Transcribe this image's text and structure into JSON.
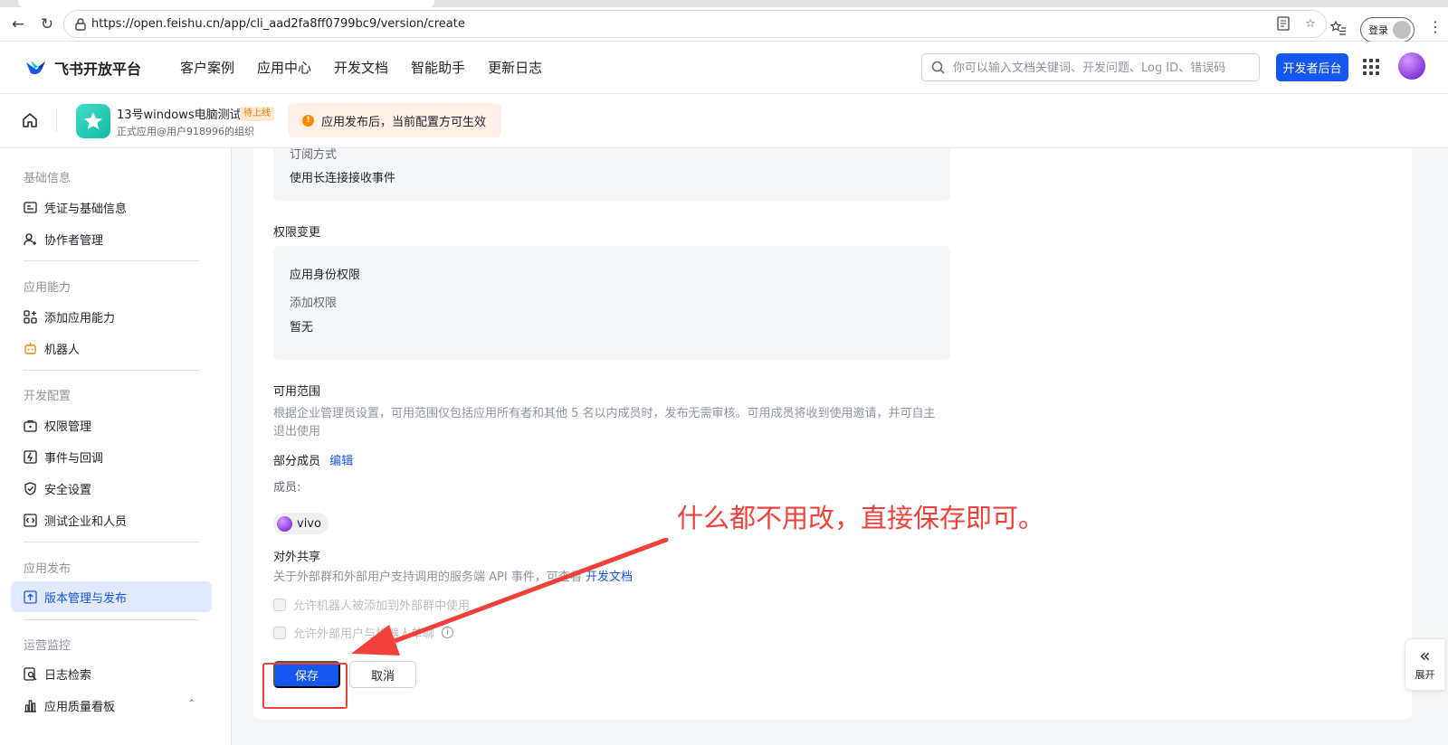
{
  "browser": {
    "url": "https://open.feishu.cn/app/cli_aad2fa8ff0799bc9/version/create",
    "login_label": "登录"
  },
  "header": {
    "brand": "飞书开放平台",
    "nav": [
      "客户案例",
      "应用中心",
      "开发文档",
      "智能助手",
      "更新日志"
    ],
    "search_placeholder": "你可以输入文档关键词、开发问题、Log ID、错误码",
    "dev_console_label": "开发者后台",
    "accent_color": "#1456f0"
  },
  "app": {
    "name": "13号windows电脑测试",
    "tag": "待上线",
    "org": "正式应用@用户918996的组织",
    "notice": "应用发布后，当前配置方可生效"
  },
  "sidebar": {
    "sections": [
      {
        "title": "基础信息",
        "items": [
          "凭证与基础信息",
          "协作者管理"
        ]
      },
      {
        "title": "应用能力",
        "items": [
          "添加应用能力",
          "机器人"
        ]
      },
      {
        "title": "开发配置",
        "items": [
          "权限管理",
          "事件与回调",
          "安全设置",
          "测试企业和人员"
        ]
      },
      {
        "title": "应用发布",
        "items": [
          "版本管理与发布"
        ]
      },
      {
        "title": "运营监控",
        "items": [
          "日志检索",
          "应用质量看板"
        ]
      }
    ],
    "active_item": "版本管理与发布"
  },
  "main": {
    "subscribe": {
      "label": "订阅方式",
      "value": "使用长连接接收事件"
    },
    "permission_change": {
      "title": "权限变更",
      "group": "应用身份权限",
      "add_label": "添加权限",
      "add_value": "暂无"
    },
    "scope": {
      "title": "可用范围",
      "desc": "根据企业管理员设置，可用范围仅包括应用所有者和其他 5 名以内成员时，发布无需审核。可用成员将收到使用邀请，并可自主退出使用",
      "partial_label": "部分成员",
      "edit_label": "编辑",
      "members_label": "成员:",
      "members": [
        "vivo"
      ]
    },
    "sharing": {
      "title": "对外共享",
      "desc": "关于外部群和外部用户支持调用的服务端 API 事件，",
      "desc_tail": "可查看",
      "docs_link": "开发文档",
      "options": [
        "允许机器人被添加到外部群中使用",
        "允许外部用户与机器人单聊"
      ]
    },
    "save_label": "保存",
    "cancel_label": "取消"
  },
  "annotation": {
    "text": "什么都不用改，直接保存即可。",
    "color": "#f2403a"
  },
  "expand_label": "展开"
}
